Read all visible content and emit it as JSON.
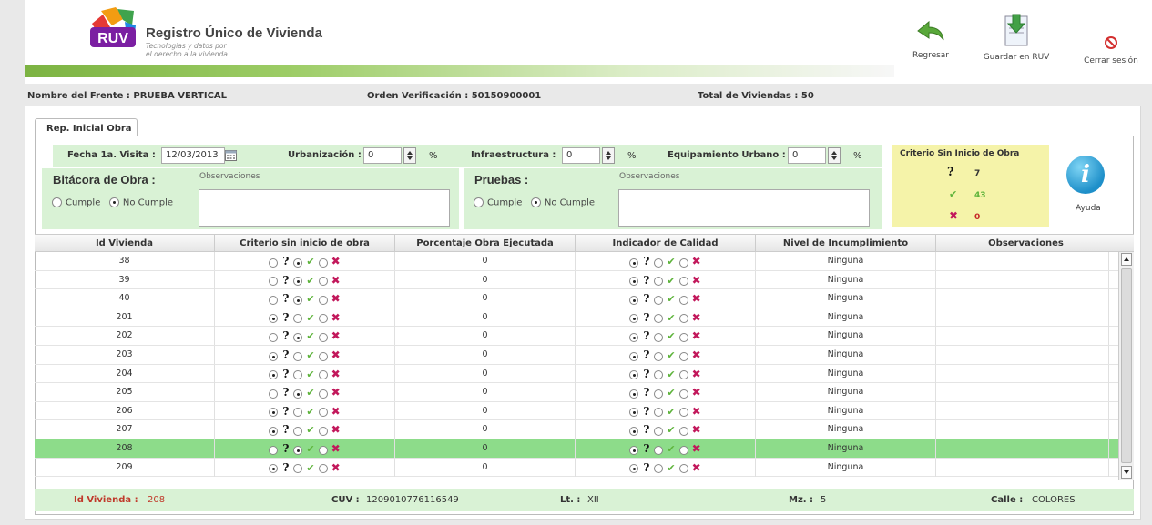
{
  "header": {
    "logo_text": "RUV",
    "title": "Registro Único de Vivienda",
    "subtitle_line1": "Tecnologías y datos por",
    "subtitle_line2": "el derecho a la vivienda",
    "tools": [
      {
        "label": "Regresar",
        "icon": "back-arrow-icon"
      },
      {
        "label": "Guardar en RUV",
        "icon": "save-document-icon"
      },
      {
        "label": "Cerrar sesión",
        "icon": "logout-icon"
      }
    ]
  },
  "info": {
    "frente": "Nombre del Frente : PRUEBA VERTICAL",
    "orden": "Orden Verificación : 50150900001",
    "total": "Total de Viviendas : 50"
  },
  "tab": {
    "label": "Rep. Inicial Obra"
  },
  "form": {
    "fecha_label": "Fecha 1a. Visita :",
    "fecha_value": "12/03/2013",
    "urbanizacion_label": "Urbanización :",
    "urbanizacion_value": "0",
    "infraestructura_label": "Infraestructura :",
    "infraestructura_value": "0",
    "equipamiento_label": "Equipamiento Urbano :",
    "equipamiento_value": "0",
    "percent": "%",
    "bitacora_label": "Bitácora de Obra :",
    "pruebas_label": "Pruebas :",
    "observaciones_placeholder": "Observaciones",
    "cumple": "Cumple",
    "no_cumple": "No Cumple"
  },
  "criteria": {
    "title": "Criterio Sin Inicio de Obra",
    "question_count": "7",
    "ok_count": "43",
    "fail_count": "0"
  },
  "help": {
    "label": "Ayuda",
    "glyph": "i"
  },
  "grid": {
    "columns": [
      "Id Vivienda",
      "Criterio sin inicio de obra",
      "Porcentaje Obra Ejecutada",
      "Indicador de Calidad",
      "Nivel de Incumplimiento",
      "Observaciones"
    ],
    "rows": [
      {
        "id": "38",
        "crit": 1,
        "pct": "0",
        "qual": 0,
        "nivel": "Ninguna",
        "selected": false
      },
      {
        "id": "39",
        "crit": 1,
        "pct": "0",
        "qual": 0,
        "nivel": "Ninguna",
        "selected": false
      },
      {
        "id": "40",
        "crit": 1,
        "pct": "0",
        "qual": 0,
        "nivel": "Ninguna",
        "selected": false
      },
      {
        "id": "201",
        "crit": 0,
        "pct": "0",
        "qual": 0,
        "nivel": "Ninguna",
        "selected": false
      },
      {
        "id": "202",
        "crit": 1,
        "pct": "0",
        "qual": 0,
        "nivel": "Ninguna",
        "selected": false
      },
      {
        "id": "203",
        "crit": 0,
        "pct": "0",
        "qual": 0,
        "nivel": "Ninguna",
        "selected": false
      },
      {
        "id": "204",
        "crit": 0,
        "pct": "0",
        "qual": 0,
        "nivel": "Ninguna",
        "selected": false
      },
      {
        "id": "205",
        "crit": 1,
        "pct": "0",
        "qual": 0,
        "nivel": "Ninguna",
        "selected": false
      },
      {
        "id": "206",
        "crit": 0,
        "pct": "0",
        "qual": 0,
        "nivel": "Ninguna",
        "selected": false
      },
      {
        "id": "207",
        "crit": 0,
        "pct": "0",
        "qual": 0,
        "nivel": "Ninguna",
        "selected": false
      },
      {
        "id": "208",
        "crit": 1,
        "pct": "0",
        "qual": 0,
        "nivel": "Ninguna",
        "selected": true
      },
      {
        "id": "209",
        "crit": 0,
        "pct": "0",
        "qual": 0,
        "nivel": "Ninguna",
        "selected": false
      }
    ]
  },
  "footer": {
    "id_label": "Id Vivienda :",
    "id_value": "208",
    "cuv_label": "CUV :",
    "cuv_value": "1209010776116549",
    "lt_label": "Lt. :",
    "lt_value": "XII",
    "mz_label": "Mz. :",
    "mz_value": "5",
    "calle_label": "Calle :",
    "calle_value": "COLORES"
  },
  "colors": {
    "accent_green": "#d9f2d5",
    "selected_row": "#8ddc8a",
    "criteria_bg": "#f5f3a9",
    "ok": "#5db33a",
    "fail": "#c2185b"
  }
}
